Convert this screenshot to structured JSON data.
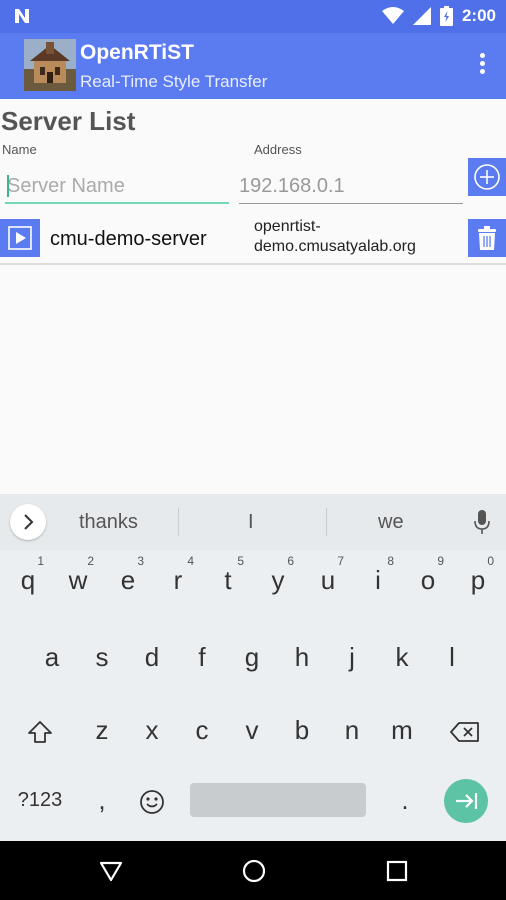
{
  "status_bar": {
    "time": "2:00",
    "notification_icon": "n-icon",
    "icons": [
      "wifi-icon",
      "signal-icon",
      "battery-icon"
    ]
  },
  "app_bar": {
    "title": "OpenRTiST",
    "subtitle": "Real-Time Style Transfer",
    "menu_icon": "overflow-menu-icon"
  },
  "server_list": {
    "heading": "Server List",
    "name_column": "Name",
    "address_column": "Address",
    "name_placeholder": "Server Name",
    "address_placeholder": "192.168.0.1",
    "servers": [
      {
        "name": "cmu-demo-server",
        "address_line1": "openrtist-",
        "address_line2": "demo.cmusatyalab.org"
      }
    ]
  },
  "keyboard": {
    "suggestions": [
      "thanks",
      "I",
      "we"
    ],
    "row1": [
      {
        "key": "q",
        "hint": "1"
      },
      {
        "key": "w",
        "hint": "2"
      },
      {
        "key": "e",
        "hint": "3"
      },
      {
        "key": "r",
        "hint": "4"
      },
      {
        "key": "t",
        "hint": "5"
      },
      {
        "key": "y",
        "hint": "6"
      },
      {
        "key": "u",
        "hint": "7"
      },
      {
        "key": "i",
        "hint": "8"
      },
      {
        "key": "o",
        "hint": "9"
      },
      {
        "key": "p",
        "hint": "0"
      }
    ],
    "row2": [
      "a",
      "s",
      "d",
      "f",
      "g",
      "h",
      "j",
      "k",
      "l"
    ],
    "row3": [
      "z",
      "x",
      "c",
      "v",
      "b",
      "n",
      "m"
    ],
    "symbols_label": "?123",
    "comma": ",",
    "period": "."
  },
  "colors": {
    "primary": "#5b7cf1",
    "status_bar": "#4f70e8",
    "accent": "#5cc3a5"
  }
}
